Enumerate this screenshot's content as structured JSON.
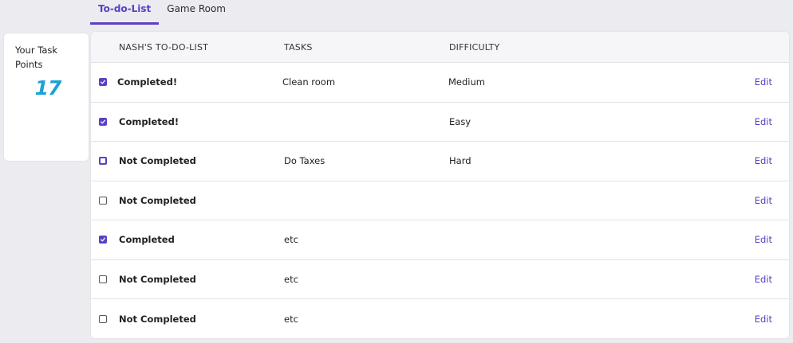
{
  "tabs": [
    {
      "label": "To-do-List",
      "active": true
    },
    {
      "label": "Game Room",
      "active": false
    }
  ],
  "points_card": {
    "label": "Your Task Points",
    "value": "17"
  },
  "table": {
    "headers": {
      "name": "NASH'S TO-DO-LIST",
      "tasks": "TASKS",
      "difficulty": "DIFFICULTY"
    },
    "rows": [
      {
        "checked": true,
        "status": "Completed!",
        "task": "Clean room",
        "difficulty": "Medium",
        "edit": "Edit"
      },
      {
        "checked": true,
        "status": "Completed!",
        "task": "",
        "difficulty": "Easy",
        "edit": "Edit"
      },
      {
        "checked": false,
        "status": "Not Completed",
        "task": "Do Taxes",
        "difficulty": "Hard",
        "edit": "Edit"
      },
      {
        "checked": false,
        "status": "Not Completed",
        "task": "",
        "difficulty": "",
        "edit": "Edit"
      },
      {
        "checked": true,
        "status": "Completed",
        "task": "etc",
        "difficulty": "",
        "edit": "Edit"
      },
      {
        "checked": false,
        "status": "Not Completed",
        "task": "etc",
        "difficulty": "",
        "edit": "Edit"
      },
      {
        "checked": false,
        "status": "Not Completed",
        "task": "etc",
        "difficulty": "",
        "edit": "Edit"
      }
    ]
  },
  "colors": {
    "accent": "#5b3fc4",
    "points": "#1ba3d6",
    "background": "#ebebf0"
  },
  "icons": {
    "checkbox_checked": "checkmark-icon"
  }
}
